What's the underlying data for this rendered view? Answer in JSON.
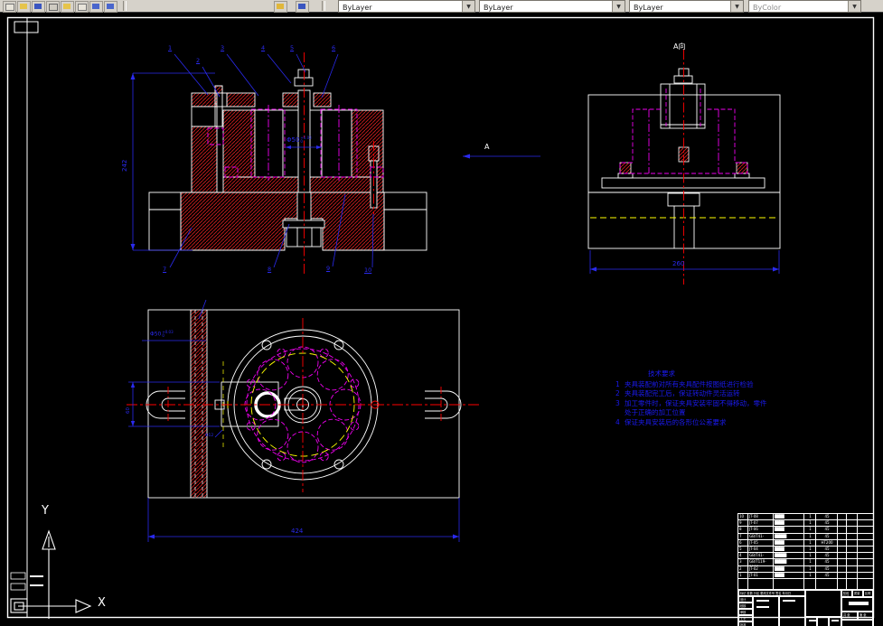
{
  "toolbar": {
    "combos": [
      {
        "label": "ByLayer"
      },
      {
        "label": "ByLayer"
      },
      {
        "label": "ByLayer"
      },
      {
        "label": "ByColor"
      }
    ]
  },
  "colors": {
    "dim_blue": "#2a2aee",
    "note_blue": "#1a1af0",
    "magenta": "#ee00ee",
    "hatch_red": "#cf1d1d",
    "centerline_red": "#ff0000",
    "phantom_yellow": "#ffff00",
    "line_white": "#ffffff"
  },
  "annotations": {
    "section": {
      "dim_height": "242",
      "bore": "Φ50",
      "bore_tol_up": "+0.03",
      "bore_tol_dn": "0",
      "cut_label": "A",
      "balloons": [
        "1",
        "2",
        "3",
        "4",
        "5",
        "6",
        "7",
        "8",
        "9",
        "10"
      ]
    },
    "side": {
      "title": "A向",
      "dim_width": "260"
    },
    "plan": {
      "dim_width": "424",
      "dim_slot": "60",
      "hole_label": "Φ50",
      "hole_tol_up": "+0.03",
      "hole_tol_dn": "0",
      "small_label": "Φ12"
    }
  },
  "notes": {
    "title": "技术要求",
    "items": [
      {
        "no": "1",
        "line1": "夹具装配前对所有夹具配件按图纸进行检验",
        "line2": ""
      },
      {
        "no": "2",
        "line1": "夹具装配完工后，保证转动件灵活运转",
        "line2": ""
      },
      {
        "no": "3",
        "line1": "加工零件时，保证夹具安装牢固不得移动，零件",
        "line2": "处于正确的加工位置"
      },
      {
        "no": "4",
        "line1": "保证夹具安装后的各形位公差要求",
        "line2": ""
      }
    ]
  },
  "bom": {
    "headers": [
      "序号",
      "代号",
      "名称",
      "数量",
      "材料",
      "单件",
      "总计",
      "备注"
    ],
    "rows": [
      {
        "no": "10",
        "code": "JT-08",
        "name": "████",
        "qty": "1",
        "mat": "45"
      },
      {
        "no": "9",
        "code": "JT-07",
        "name": "████",
        "qty": "1",
        "mat": "45"
      },
      {
        "no": "8",
        "code": "JT-06",
        "name": "████",
        "qty": "1",
        "mat": "45"
      },
      {
        "no": "7",
        "code": "GB/T41-2000",
        "name": "█████",
        "qty": "1",
        "mat": "45"
      },
      {
        "no": "6",
        "code": "JT-05",
        "name": "████",
        "qty": "1",
        "mat": "HT200"
      },
      {
        "no": "5",
        "code": "JT-04",
        "name": "████",
        "qty": "1",
        "mat": "45"
      },
      {
        "no": "4",
        "code": "GB/T41-2000",
        "name": "█████",
        "qty": "1",
        "mat": "45"
      },
      {
        "no": "3",
        "code": "GB/T119-2000",
        "name": "█████",
        "qty": "1",
        "mat": "45"
      },
      {
        "no": "2",
        "code": "JT-02",
        "name": "████",
        "qty": "1",
        "mat": "45"
      },
      {
        "no": "1",
        "code": "JT-01",
        "name": "████",
        "qty": "1",
        "mat": "45"
      }
    ]
  },
  "title_block": {
    "revision_header": "标记 处数 分区 更改文件号 签名 年月日",
    "sign_labels": [
      "设计",
      "校核",
      "审核",
      "工艺",
      "批准"
    ],
    "right_labels": [
      "阶段标记",
      "质量",
      "比例"
    ],
    "sheet_labels": [
      "共 张",
      "第 张"
    ]
  },
  "ucs": {
    "x": "X",
    "y": "Y"
  }
}
